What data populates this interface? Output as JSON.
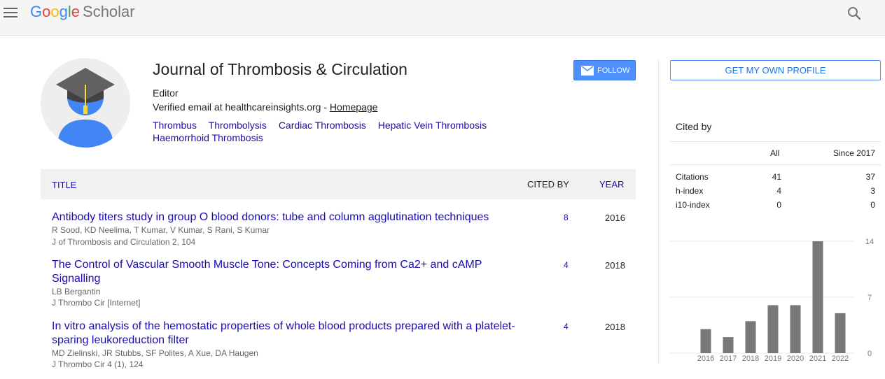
{
  "header": {
    "logo_google": [
      "G",
      "o",
      "o",
      "g",
      "l",
      "e"
    ],
    "logo_colors": [
      "#4285f4",
      "#ea4335",
      "#fbbc05",
      "#4285f4",
      "#34a853",
      "#ea4335"
    ],
    "logo_scholar": "Scholar",
    "menu_icon": "hamburger-menu-icon",
    "search_icon": "search-icon"
  },
  "profile": {
    "name": "Journal of Thrombosis & Circulation",
    "affiliation": "Editor",
    "email_text": "Verified email at healthcareinsights.org - ",
    "homepage": "Homepage",
    "interests": [
      "Thrombus",
      "Thrombolysis",
      "Cardiac Thrombosis",
      "Hepatic Vein Thrombosis",
      "Haemorrhoid Thrombosis"
    ],
    "follow_label": "FOLLOW"
  },
  "table": {
    "col_title": "TITLE",
    "col_cited": "CITED BY",
    "col_year": "YEAR",
    "rows": [
      {
        "title": "Antibody titers study in group O blood donors: tube and column agglutination techniques",
        "authors": "R Sood, KD Neelima, T Kumar, V Kumar, S Rani, S Kumar",
        "venue": "J of Thrombosis and Circulation 2, 104",
        "cited": "8",
        "year": "2016"
      },
      {
        "title": "The Control of Vascular Smooth Muscle Tone: Concepts Coming from Ca2+ and cAMP Signalling",
        "authors": "LB Bergantin",
        "venue": "J Thrombo Cir [Internet]",
        "cited": "4",
        "year": "2018"
      },
      {
        "title": "In vitro analysis of the hemostatic properties of whole blood products prepared with a platelet-sparing leukoreduction filter",
        "authors": "MD Zielinski, JR Stubbs, SF Polites, A Xue, DA Haugen",
        "venue": "J Thrombo Cir 4 (1), 124",
        "cited": "4",
        "year": "2018"
      }
    ]
  },
  "sidebar": {
    "get_profile": "GET MY OWN PROFILE",
    "cited_by": "Cited by",
    "col_all": "All",
    "col_since": "Since 2017",
    "stats": [
      {
        "label": "Citations",
        "all": "41",
        "since": "37"
      },
      {
        "label": "h-index",
        "all": "4",
        "since": "3"
      },
      {
        "label": "i10-index",
        "all": "0",
        "since": "0"
      }
    ]
  },
  "chart_data": {
    "type": "bar",
    "categories": [
      "2016",
      "2017",
      "2018",
      "2019",
      "2020",
      "2021",
      "2022"
    ],
    "values": [
      3,
      2,
      4,
      6,
      6,
      14,
      5
    ],
    "yticks": [
      "14",
      "7",
      "0"
    ],
    "ylim": [
      0,
      14
    ],
    "bar_color": "#777777",
    "grid": true
  }
}
